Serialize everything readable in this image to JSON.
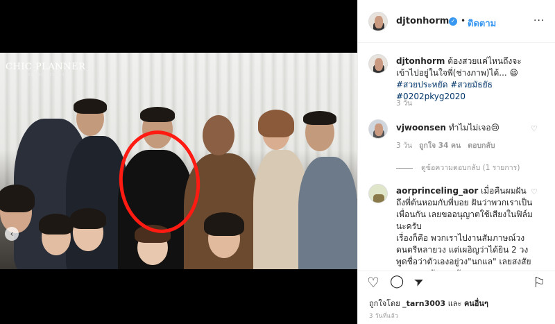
{
  "media": {
    "brand_title": "CHIC PLANNER",
    "brand_subtitle": "WEDDING & EVENTS",
    "prev_icon": "‹"
  },
  "header": {
    "username": "djtonhorm",
    "verified_icon": "✓",
    "separator": "•",
    "follow_label": "ติดตาม",
    "more_icon": "···"
  },
  "comments": [
    {
      "username": "djtonhorm",
      "text": "ต้องสวยแค่ไหนถึงจะเข้าไปอยู่ในใจพี่(ช่างภาพ)ได้... 😄 ",
      "tags": "#สวยประหยัด #สวยมัธยัธ #0202pkyg2020",
      "time": "3 วัน"
    },
    {
      "username": "vjwoonsen",
      "text": "ทำไมไม่เจอ😢",
      "time": "3 วัน",
      "likes": "ถูกใจ 34 คน",
      "reply": "ตอบกลับ",
      "view_replies": "ดูข้อความตอบกลับ (1 รายการ)"
    },
    {
      "username": "aorprinceling_aor",
      "text": "เมื่อคืนผมฝันถึงพี่ต้นหอมกับพี่บอย ฝันว่าพวกเราเป็นเพื่อนกัน เลยขออนุญาตใช้เสียงในฟิล์มนะครับ",
      "text2": "เรื่องก็คือ พวกเราไปงานสัมภาษณ์วงดนตรีหลายวง แต่เผอิญว่าได้ยิน 2 วงพูดชื่อว่าตัวเองอยู่วง\"นกแล\" เลยสงสัยเลยมาคุยกันนะครับ"
    }
  ],
  "actions": {
    "like_icon": "♡",
    "comment_icon": "◯",
    "share_icon": "➤",
    "save_icon": "⚐"
  },
  "liked_by": {
    "prefix": "ถูกใจโดย ",
    "user": "_tarn3003",
    "mid": " และ ",
    "others": "คนอื่นๆ"
  },
  "timestamp": "3 วันที่แล้ว"
}
